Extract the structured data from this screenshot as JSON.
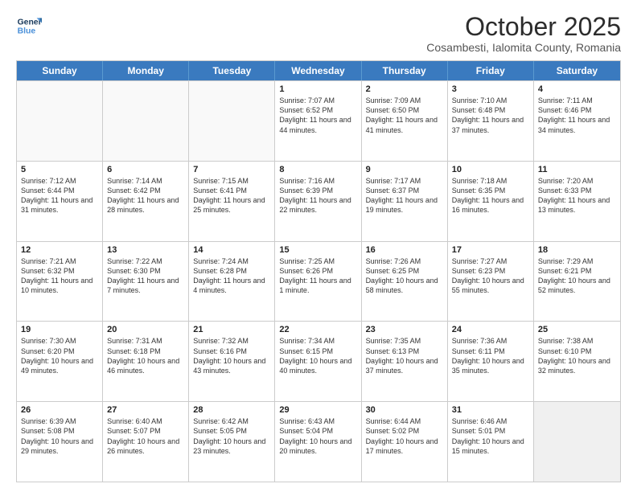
{
  "header": {
    "logo_line1": "General",
    "logo_line2": "Blue",
    "month": "October 2025",
    "location": "Cosambesti, Ialomita County, Romania"
  },
  "days_of_week": [
    "Sunday",
    "Monday",
    "Tuesday",
    "Wednesday",
    "Thursday",
    "Friday",
    "Saturday"
  ],
  "weeks": [
    [
      {
        "day": "",
        "info": ""
      },
      {
        "day": "",
        "info": ""
      },
      {
        "day": "",
        "info": ""
      },
      {
        "day": "1",
        "info": "Sunrise: 7:07 AM\nSunset: 6:52 PM\nDaylight: 11 hours and 44 minutes."
      },
      {
        "day": "2",
        "info": "Sunrise: 7:09 AM\nSunset: 6:50 PM\nDaylight: 11 hours and 41 minutes."
      },
      {
        "day": "3",
        "info": "Sunrise: 7:10 AM\nSunset: 6:48 PM\nDaylight: 11 hours and 37 minutes."
      },
      {
        "day": "4",
        "info": "Sunrise: 7:11 AM\nSunset: 6:46 PM\nDaylight: 11 hours and 34 minutes."
      }
    ],
    [
      {
        "day": "5",
        "info": "Sunrise: 7:12 AM\nSunset: 6:44 PM\nDaylight: 11 hours and 31 minutes."
      },
      {
        "day": "6",
        "info": "Sunrise: 7:14 AM\nSunset: 6:42 PM\nDaylight: 11 hours and 28 minutes."
      },
      {
        "day": "7",
        "info": "Sunrise: 7:15 AM\nSunset: 6:41 PM\nDaylight: 11 hours and 25 minutes."
      },
      {
        "day": "8",
        "info": "Sunrise: 7:16 AM\nSunset: 6:39 PM\nDaylight: 11 hours and 22 minutes."
      },
      {
        "day": "9",
        "info": "Sunrise: 7:17 AM\nSunset: 6:37 PM\nDaylight: 11 hours and 19 minutes."
      },
      {
        "day": "10",
        "info": "Sunrise: 7:18 AM\nSunset: 6:35 PM\nDaylight: 11 hours and 16 minutes."
      },
      {
        "day": "11",
        "info": "Sunrise: 7:20 AM\nSunset: 6:33 PM\nDaylight: 11 hours and 13 minutes."
      }
    ],
    [
      {
        "day": "12",
        "info": "Sunrise: 7:21 AM\nSunset: 6:32 PM\nDaylight: 11 hours and 10 minutes."
      },
      {
        "day": "13",
        "info": "Sunrise: 7:22 AM\nSunset: 6:30 PM\nDaylight: 11 hours and 7 minutes."
      },
      {
        "day": "14",
        "info": "Sunrise: 7:24 AM\nSunset: 6:28 PM\nDaylight: 11 hours and 4 minutes."
      },
      {
        "day": "15",
        "info": "Sunrise: 7:25 AM\nSunset: 6:26 PM\nDaylight: 11 hours and 1 minute."
      },
      {
        "day": "16",
        "info": "Sunrise: 7:26 AM\nSunset: 6:25 PM\nDaylight: 10 hours and 58 minutes."
      },
      {
        "day": "17",
        "info": "Sunrise: 7:27 AM\nSunset: 6:23 PM\nDaylight: 10 hours and 55 minutes."
      },
      {
        "day": "18",
        "info": "Sunrise: 7:29 AM\nSunset: 6:21 PM\nDaylight: 10 hours and 52 minutes."
      }
    ],
    [
      {
        "day": "19",
        "info": "Sunrise: 7:30 AM\nSunset: 6:20 PM\nDaylight: 10 hours and 49 minutes."
      },
      {
        "day": "20",
        "info": "Sunrise: 7:31 AM\nSunset: 6:18 PM\nDaylight: 10 hours and 46 minutes."
      },
      {
        "day": "21",
        "info": "Sunrise: 7:32 AM\nSunset: 6:16 PM\nDaylight: 10 hours and 43 minutes."
      },
      {
        "day": "22",
        "info": "Sunrise: 7:34 AM\nSunset: 6:15 PM\nDaylight: 10 hours and 40 minutes."
      },
      {
        "day": "23",
        "info": "Sunrise: 7:35 AM\nSunset: 6:13 PM\nDaylight: 10 hours and 37 minutes."
      },
      {
        "day": "24",
        "info": "Sunrise: 7:36 AM\nSunset: 6:11 PM\nDaylight: 10 hours and 35 minutes."
      },
      {
        "day": "25",
        "info": "Sunrise: 7:38 AM\nSunset: 6:10 PM\nDaylight: 10 hours and 32 minutes."
      }
    ],
    [
      {
        "day": "26",
        "info": "Sunrise: 6:39 AM\nSunset: 5:08 PM\nDaylight: 10 hours and 29 minutes."
      },
      {
        "day": "27",
        "info": "Sunrise: 6:40 AM\nSunset: 5:07 PM\nDaylight: 10 hours and 26 minutes."
      },
      {
        "day": "28",
        "info": "Sunrise: 6:42 AM\nSunset: 5:05 PM\nDaylight: 10 hours and 23 minutes."
      },
      {
        "day": "29",
        "info": "Sunrise: 6:43 AM\nSunset: 5:04 PM\nDaylight: 10 hours and 20 minutes."
      },
      {
        "day": "30",
        "info": "Sunrise: 6:44 AM\nSunset: 5:02 PM\nDaylight: 10 hours and 17 minutes."
      },
      {
        "day": "31",
        "info": "Sunrise: 6:46 AM\nSunset: 5:01 PM\nDaylight: 10 hours and 15 minutes."
      },
      {
        "day": "",
        "info": ""
      }
    ]
  ]
}
